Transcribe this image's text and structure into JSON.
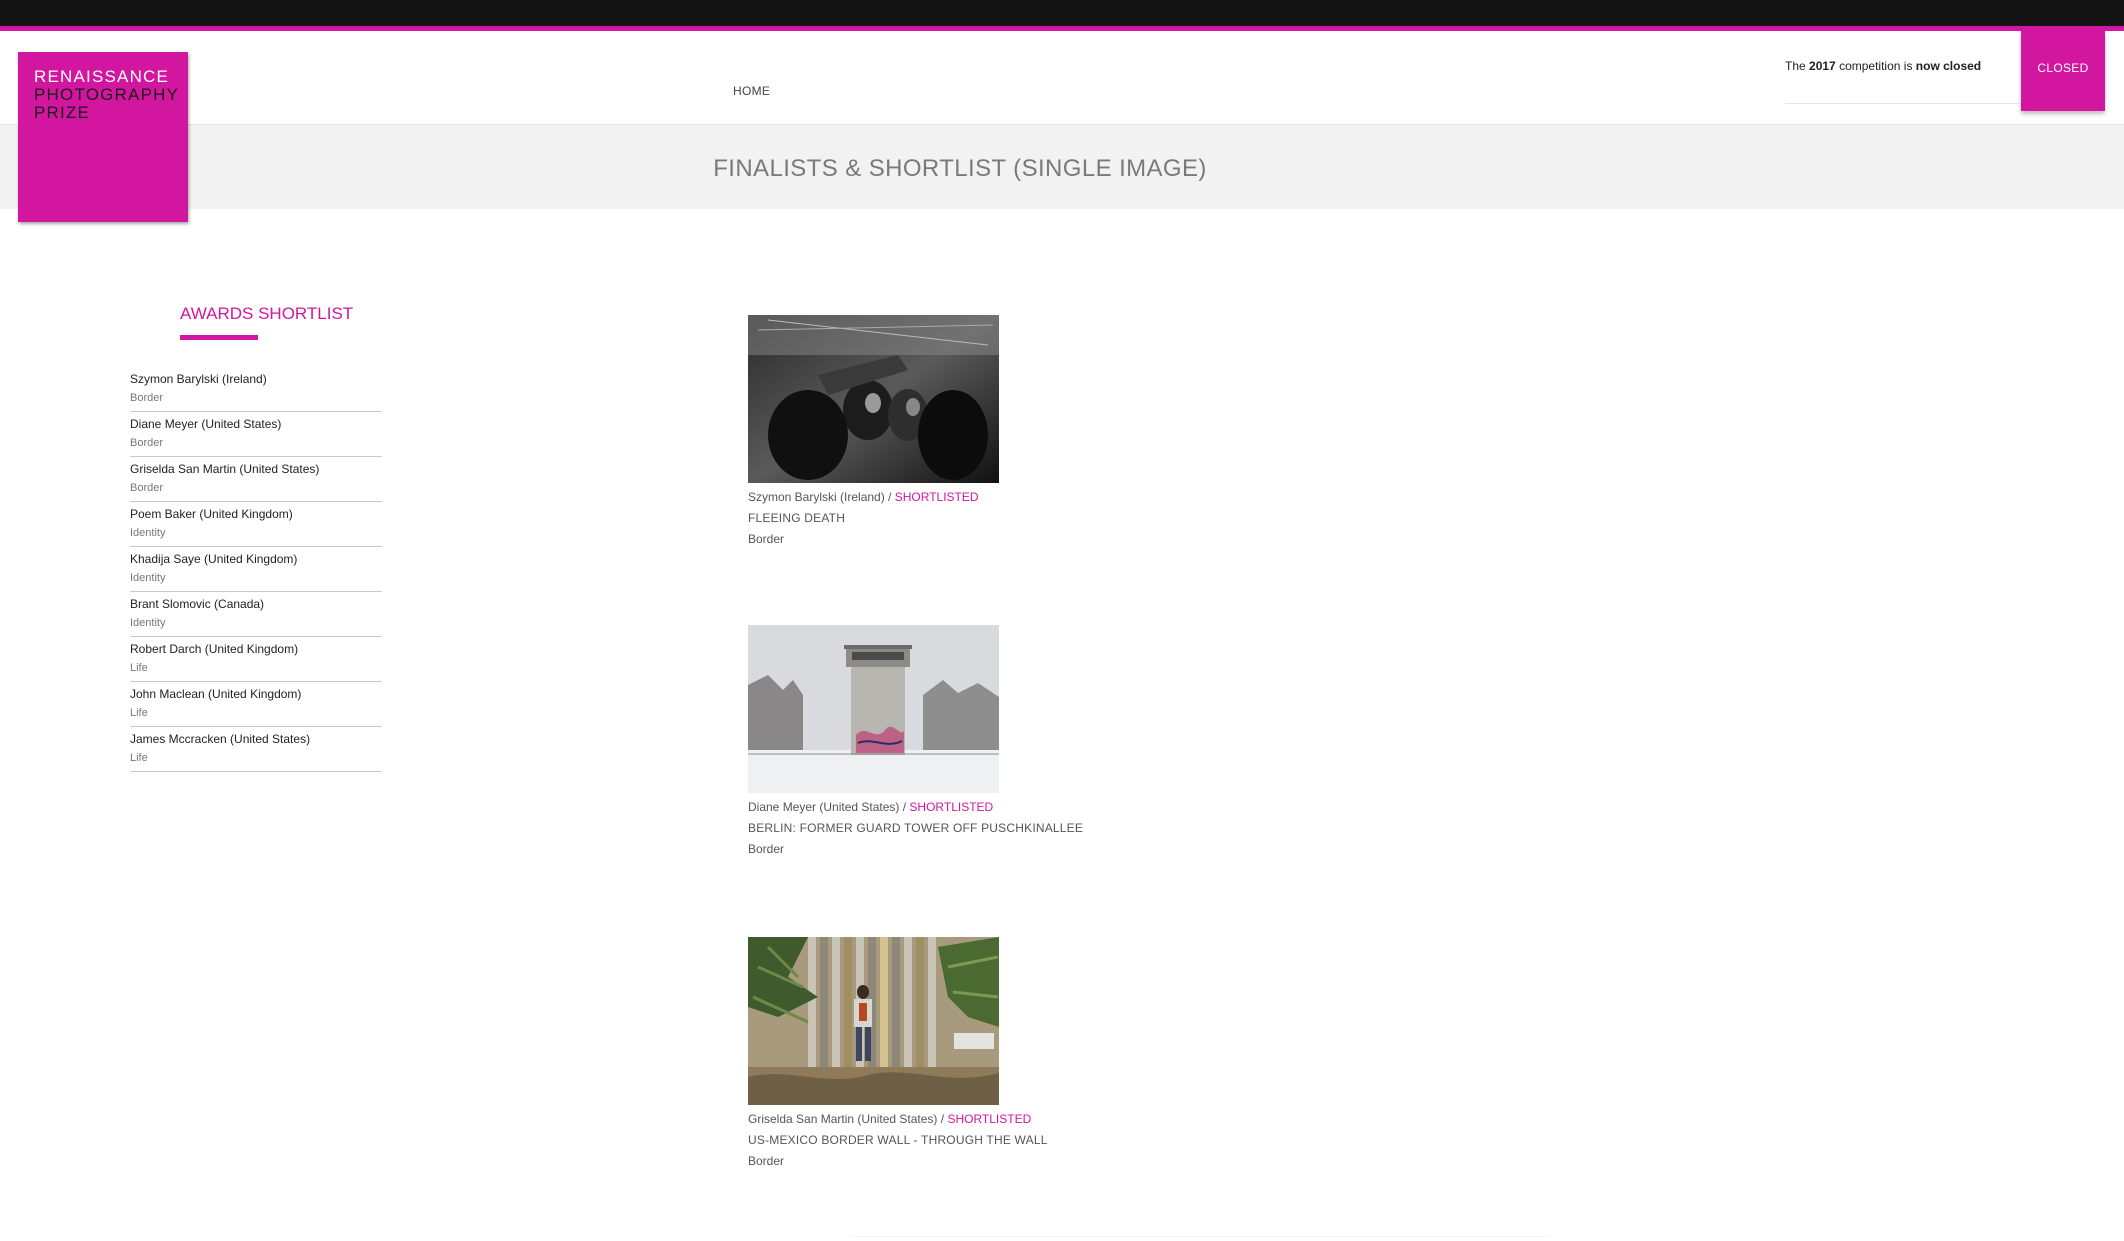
{
  "colors": {
    "brand": "#d2169f",
    "topbar": "#141414",
    "title_band": "#f2f2f2"
  },
  "logo": {
    "line1": "RENAISSANCE",
    "line2": "PHOTOGRAPHY",
    "line3": "PRIZE"
  },
  "nav": {
    "home": "HOME"
  },
  "competition": {
    "prefix": "The",
    "year": "2017",
    "middle": "competition is",
    "status": "now closed",
    "closed_label": "CLOSED"
  },
  "page": {
    "title": "FINALISTS & SHORTLIST (SINGLE IMAGE)"
  },
  "sidebar": {
    "heading": "AWARDS SHORTLIST",
    "items": [
      {
        "name": "Szymon Barylski (Ireland)",
        "category": "Border"
      },
      {
        "name": "Diane Meyer (United States)",
        "category": "Border"
      },
      {
        "name": "Griselda San Martin (United States)",
        "category": "Border"
      },
      {
        "name": "Poem Baker (United Kingdom)",
        "category": "Identity"
      },
      {
        "name": "Khadija Saye (United Kingdom)",
        "category": "Identity"
      },
      {
        "name": "Brant Slomovic (Canada)",
        "category": "Identity"
      },
      {
        "name": "Robert Darch (United Kingdom)",
        "category": "Life"
      },
      {
        "name": "John Maclean (United Kingdom)",
        "category": "Life"
      },
      {
        "name": "James Mccracken (United States)",
        "category": "Life"
      }
    ]
  },
  "entries": [
    {
      "photographer": "Szymon Barylski (Ireland)",
      "separator": " / ",
      "status": "SHORTLISTED",
      "title": "FLEEING DEATH",
      "category": "Border",
      "image": "black-and-white crowd photograph"
    },
    {
      "photographer": "Diane Meyer (United States)",
      "separator": " / ",
      "status": "SHORTLISTED",
      "title": "BERLIN: FORMER GUARD TOWER OFF PUSCHKINALLEE",
      "category": "Border",
      "image": "guard tower in snow photograph"
    },
    {
      "photographer": "Griselda San Martin (United States)",
      "separator": " / ",
      "status": "SHORTLISTED",
      "title": "US-MEXICO BORDER WALL - THROUGH THE WALL",
      "category": "Border",
      "image": "person at border wall with palms photograph"
    }
  ]
}
